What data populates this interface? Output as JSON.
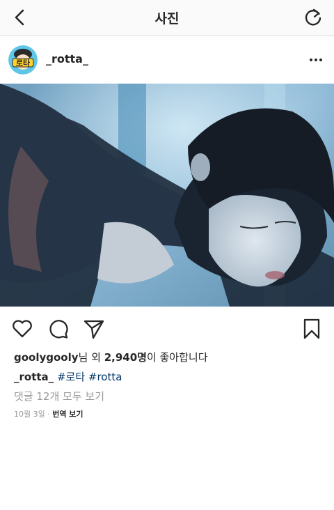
{
  "header": {
    "title": "사진"
  },
  "post": {
    "username": "_rotta_",
    "avatar_text": "로타"
  },
  "likes": {
    "user": "goolygooly",
    "text_1": "님 외 ",
    "count": "2,940명",
    "text_2": "이 좋아합니다"
  },
  "caption": {
    "username": "_rotta_",
    "tags": [
      "#로타",
      "#rotta"
    ]
  },
  "comments": {
    "view_all": "댓글 12개 모두 보기"
  },
  "meta": {
    "date": "10월 3일",
    "separator": "·",
    "translate": "번역 보기"
  },
  "icons": {
    "back": "chevron-left-icon",
    "refresh": "refresh-icon",
    "more": "more-horizontal-icon",
    "like": "heart-icon",
    "comment": "comment-icon",
    "share": "send-icon",
    "bookmark": "bookmark-icon"
  },
  "colors": {
    "text": "#262626",
    "muted": "#999999",
    "hashtag": "#003569",
    "border": "#dbdbdb"
  }
}
